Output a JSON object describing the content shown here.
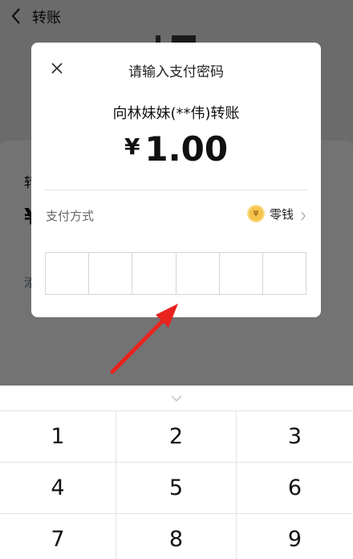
{
  "nav": {
    "title": "转账"
  },
  "background": {
    "label_partial": "转",
    "yen_partial": "¥",
    "note_partial": "添"
  },
  "dialog": {
    "title": "请输入支付密码",
    "payee": "向林妹妹(**伟)转账",
    "currency": "¥",
    "amount": "1.00",
    "payment_method_label": "支付方式",
    "payment_method_value": "零钱",
    "coin_glyph": "¥",
    "pin_length": 6
  },
  "keyboard": {
    "keys": [
      "1",
      "2",
      "3",
      "4",
      "5",
      "6",
      "7",
      "8",
      "9"
    ]
  },
  "colors": {
    "accent_arrow": "#e8231f",
    "coin": "#f6c44c"
  }
}
